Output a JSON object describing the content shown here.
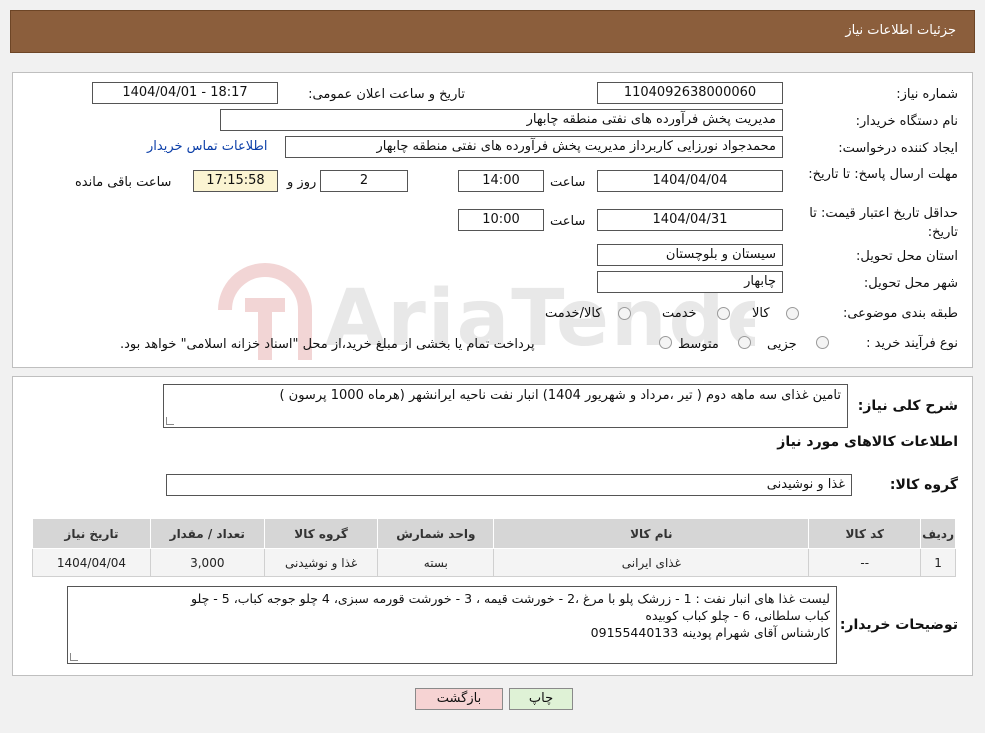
{
  "header": {
    "title": "جزئیات اطلاعات نیاز"
  },
  "form": {
    "need_number_label": "شماره نیاز:",
    "need_number": "1104092638000060",
    "announce_label": "تاریخ و ساعت اعلان عمومی:",
    "announce_value": "1404/04/01 - 18:17",
    "buyer_label": "نام دستگاه خریدار:",
    "buyer_value": "مدیریت پخش فرآورده های نفتی منطقه چابهار",
    "creator_label": "ایجاد کننده درخواست:",
    "creator_value": "محمدجواد نورزایی کاربرداز مدیریت پخش فرآورده های نفتی منطقه چابهار",
    "contact_link": "اطلاعات تماس خریدار",
    "deadline_label": "مهلت ارسال پاسخ: تا تاریخ:",
    "deadline_date": "1404/04/04",
    "time_label": "ساعت",
    "deadline_time": "14:00",
    "days_value": "2",
    "days_label": "روز و",
    "remaining_time": "17:15:58",
    "remaining_label": "ساعت باقی مانده",
    "validity_label": "حداقل تاریخ اعتبار قیمت: تا تاریخ:",
    "validity_date": "1404/04/31",
    "validity_time": "10:00",
    "province_label": "استان محل تحویل:",
    "province_value": "سیستان و بلوچستان",
    "city_label": "شهر محل تحویل:",
    "city_value": "چابهار",
    "category_label": "طبقه بندی موضوعی:",
    "category_options": [
      "کالا",
      "خدمت",
      "کالا/خدمت"
    ],
    "process_label": "نوع فرآیند خرید :",
    "process_options": [
      "جزیی",
      "متوسط"
    ],
    "process_note": "پرداخت تمام یا بخشی از مبلغ خرید،از محل \"اسناد خزانه اسلامی\" خواهد بود."
  },
  "summary": {
    "label": "شرح کلی نیاز:",
    "value": "تامین غذای سه ماهه دوم ( تیر ،مرداد و شهریور  1404) انبار نفت ناحیه ایرانشهر (هرماه 1000 پرسون )"
  },
  "goods": {
    "section_title": "اطلاعات کالاهای مورد نیاز",
    "group_label": "گروه کالا:",
    "group_value": "غذا و نوشیدنی",
    "columns": [
      "ردیف",
      "کد کالا",
      "نام کالا",
      "واحد شمارش",
      "گروه کالا",
      "تعداد / مقدار",
      "تاریخ نیاز"
    ],
    "rows": [
      [
        "1",
        "--",
        "غذای ایرانی",
        "بسته",
        "غذا و نوشیدنی",
        "3,000",
        "1404/04/04"
      ]
    ]
  },
  "notes": {
    "label": "توضیحات خریدار:",
    "lines": [
      "لیست غذا های انبار نفت : 1 - زرشک پلو با مرغ ،2 - خورشت قیمه ، 3 - خورشت قورمه سبزی، 4 چلو جوجه کباب، 5 - چلو",
      "کباب سلطانی، 6 - چلو کباب  کوبیده",
      " کارشناس آقای شهرام پودینه 09155440133"
    ]
  },
  "buttons": {
    "print": "چاپ",
    "back": "بازگشت"
  },
  "colors": {
    "header_bg": "#8b5e3c",
    "back_button_bg": "#f6d3d3",
    "print_button_bg": "#dff2d6",
    "remaining_bg": "#fbf4d2",
    "link": "#0b3ea8"
  }
}
